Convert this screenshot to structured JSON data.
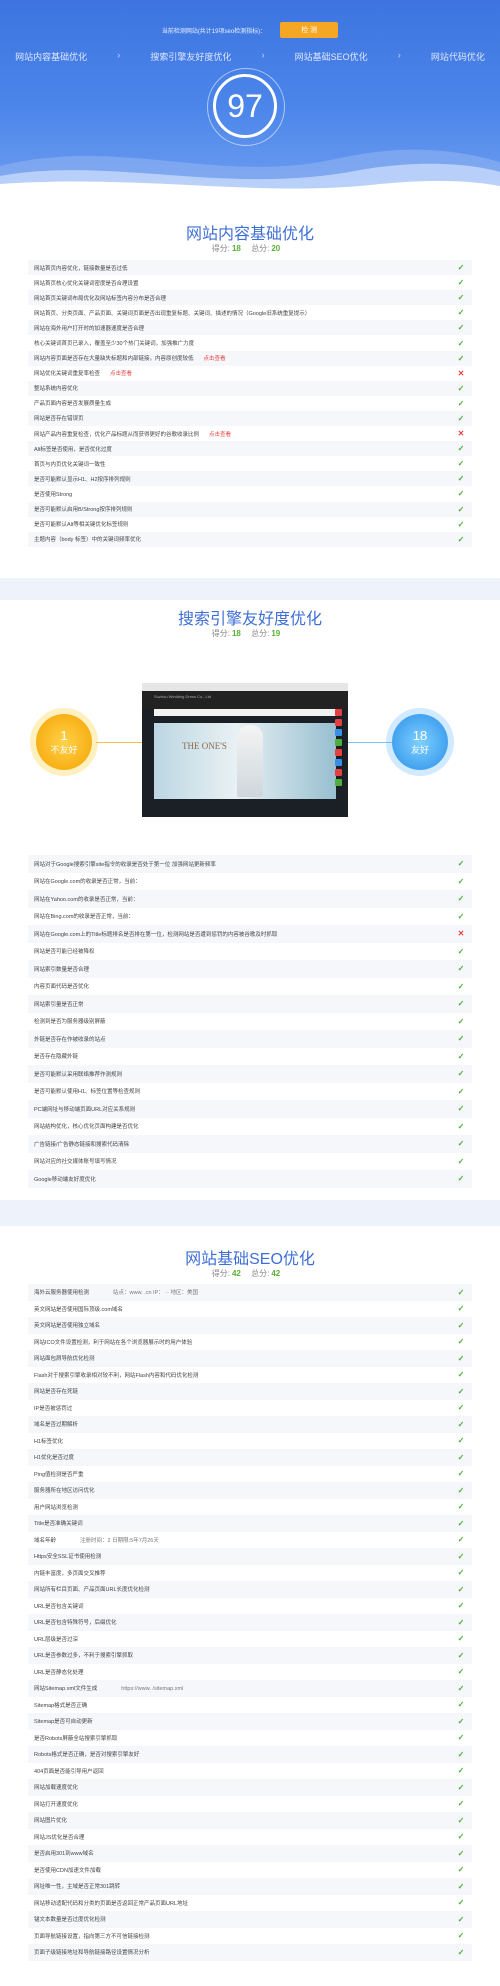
{
  "hero": {
    "hint": "当前检测网站(共计19项seo检测指标)：",
    "button_label": "检 测",
    "nav": [
      "网站内容基础优化",
      "搜索引擎友好度优化",
      "网站基础SEO优化",
      "网站代码优化"
    ],
    "score": "97"
  },
  "colors": {
    "accent": "#3f6fd6",
    "ok": "#4caf3c",
    "bad": "#e54040",
    "warn": "#f5a623"
  },
  "sections": {
    "content": {
      "title": "网站内容基础优化",
      "score_label": "得分:",
      "score": "18",
      "total_label": "总分:",
      "total": "20",
      "rows": [
        {
          "text": "网站首页内容优化，链接数量是否过低",
          "tag": "",
          "status": "ok"
        },
        {
          "text": "网站首页核心优化关键词密度是否合理设置",
          "tag": "",
          "status": "ok"
        },
        {
          "text": "网站首页关键词布局优化及网站标签内容分布是否合理",
          "tag": "",
          "status": "ok"
        },
        {
          "text": "网站首页、分类页面、产品页面、关键词页面是否出现重复标题、关键词、描述的情况（Google旧系统重复提示）",
          "tag": "",
          "status": "ok"
        },
        {
          "text": "网站在海外用户打开时的加速器速度是否合理",
          "tag": "",
          "status": "ok"
        },
        {
          "text": "核心关键词首页已录入，覆盖至少30个热门关键词，加强推广力度",
          "tag": "",
          "status": "ok"
        },
        {
          "text": "网站内容页面是否存在大量缺失标题和内部链接，内容原创度较低",
          "tag": "点击查看",
          "status": "ok"
        },
        {
          "text": "网站优化关键词重复率检查",
          "tag": "点击查看",
          "status": "bad"
        },
        {
          "text": "整站系统内容优化",
          "tag": "",
          "status": "ok"
        },
        {
          "text": "产品页面内容是否发展质量生成",
          "tag": "",
          "status": "ok"
        },
        {
          "text": "网站是否存在错误页",
          "tag": "",
          "status": "ok"
        },
        {
          "text": "网站产品内容重复检查，优化产品标题从而获得更好的谷歌收录比例",
          "tag": "点击查看",
          "status": "bad"
        },
        {
          "text": "Alt标签是否使用，是否优化过度",
          "tag": "",
          "status": "ok"
        },
        {
          "text": "首页与内页优化关键词一致性",
          "tag": "",
          "status": "ok"
        },
        {
          "text": "是否可能默认显示H1、H2按序排列规则",
          "tag": "",
          "status": "ok"
        },
        {
          "text": "是否使用Strong",
          "tag": "",
          "status": "ok"
        },
        {
          "text": "是否可能默认启用B/Strong按序排列规则",
          "tag": "",
          "status": "ok"
        },
        {
          "text": "是否可能默认Alt等相关键优化标签规则",
          "tag": "",
          "status": "ok"
        },
        {
          "text": "主题内容（body 标签）中的关键词频率优化",
          "tag": "",
          "status": "ok"
        }
      ]
    },
    "search": {
      "title": "搜索引擎友好度优化",
      "score_label": "得分:",
      "score": "18",
      "total_label": "总分:",
      "total": "19",
      "left_badge": {
        "num": "1",
        "label": "不友好"
      },
      "right_badge": {
        "num": "18",
        "label": "友好"
      },
      "preview": {
        "site_name": "Suzhou Wedding Dress Co., Ltd",
        "logo": "THE ONE'S"
      },
      "rows": [
        {
          "text": "网站对于Google搜索引擎site指令的收录是否处于第一位 加强网站更新频率",
          "tag": "",
          "status": "ok"
        },
        {
          "text": "网站在Google.com的收录是否正常，当前：",
          "tag": "",
          "status": "ok"
        },
        {
          "text": "网站在Yahoo.com的收录是否正常，当前：",
          "tag": "",
          "status": "ok"
        },
        {
          "text": "网站在Bing.com的收录是否正常，当前：",
          "tag": "",
          "status": "ok"
        },
        {
          "text": "网站在Google.com上的Title标题排名是否排在第一位，检测网站是否遭到惩罚的内容被谷歌及时抓取",
          "tag": "",
          "status": "bad"
        },
        {
          "text": "网站是否可能已经被降权",
          "tag": "",
          "status": "ok"
        },
        {
          "text": "网站索引数量是否合理",
          "tag": "",
          "status": "ok"
        },
        {
          "text": "内容页面代码是否优化",
          "tag": "",
          "status": "ok"
        },
        {
          "text": "网站索引量是否正常",
          "tag": "",
          "status": "ok"
        },
        {
          "text": "检测到是否为服务器级别屏蔽",
          "tag": "",
          "status": "ok"
        },
        {
          "text": "外链是否存在作被收录的站点",
          "tag": "",
          "status": "ok"
        },
        {
          "text": "是否存在隐藏外链",
          "tag": "",
          "status": "ok"
        },
        {
          "text": "是否可能默认采用联络推荐作测规则",
          "tag": "",
          "status": "ok"
        },
        {
          "text": "是否可能默认使用H1、标签位置等检查规则",
          "tag": "",
          "status": "ok"
        },
        {
          "text": "PC端网址与移动端页面URL对应关系规则",
          "tag": "",
          "status": "ok"
        },
        {
          "text": "网站结构优化，核心优化页面构建是否优化",
          "tag": "",
          "status": "ok"
        },
        {
          "text": "广告链接/广告静态链接和搜索代码清除",
          "tag": "",
          "status": "ok"
        },
        {
          "text": "网站对应的社交媒体账号填写情况",
          "tag": "",
          "status": "ok"
        },
        {
          "text": "Google移动端友好度优化",
          "tag": "",
          "status": "ok"
        }
      ]
    },
    "seo": {
      "title": "网站基础SEO优化",
      "score_label": "得分:",
      "score": "42",
      "total_label": "总分:",
      "total": "42",
      "rows": [
        {
          "text": "海外云服务器使用检测",
          "extra": "站点：www.                                .cn IP：           ·· 地区：美国",
          "status": "ok"
        },
        {
          "text": "英文网站是否使用国际顶级.com域名",
          "extra": "",
          "status": "ok"
        },
        {
          "text": "英文网站是否使用独立域名",
          "extra": "",
          "status": "ok"
        },
        {
          "text": "网站ICO文件设置检测，利于网站在各个浏览器展示时的用户体验",
          "extra": "",
          "status": "ok"
        },
        {
          "text": "网站面包屑导航优化检测",
          "extra": "",
          "status": "ok"
        },
        {
          "text": "Flash对于搜索引擎收录相对较不利，网站Flash内容和代码优化检测",
          "extra": "",
          "status": "ok"
        },
        {
          "text": "网站是否存在死链",
          "extra": "",
          "status": "ok"
        },
        {
          "text": "IP是否被惩罚过",
          "extra": "",
          "status": "ok"
        },
        {
          "text": "域名是否过期解析",
          "extra": "",
          "status": "ok"
        },
        {
          "text": "H1标签优化",
          "extra": "",
          "status": "ok"
        },
        {
          "text": "H1优化是否过度",
          "extra": "",
          "status": "ok"
        },
        {
          "text": "Ping值检测是否严重",
          "extra": "",
          "status": "ok"
        },
        {
          "text": "服务器所在地区访问优化",
          "extra": "",
          "status": "ok"
        },
        {
          "text": "用户网站浏览检测",
          "extra": "",
          "status": "ok"
        },
        {
          "text": "Title是否准确关键词",
          "extra": "",
          "status": "ok"
        },
        {
          "text": "域名年龄",
          "extra": "注册时间：2         日期限:5年7月26天",
          "status": "ok"
        },
        {
          "text": "Https安全SSL证书使用检测",
          "extra": "",
          "status": "ok"
        },
        {
          "text": "内链丰富度，多页面交叉推荐",
          "extra": "",
          "status": "ok"
        },
        {
          "text": "网站所有栏目页面、产品页面URL长度优化检测",
          "extra": "",
          "status": "ok"
        },
        {
          "text": "URL是否包含关键词",
          "extra": "",
          "status": "ok"
        },
        {
          "text": "URL是否包含特殊符号，后缀优化",
          "extra": "",
          "status": "ok"
        },
        {
          "text": "URL层级是否过深",
          "extra": "",
          "status": "ok"
        },
        {
          "text": "URL是否参数过多，不利于搜索引擎抓取",
          "extra": "",
          "status": "ok"
        },
        {
          "text": "URL是否静态化处理",
          "extra": "",
          "status": "ok"
        },
        {
          "text": "网站Sitemap.xml文件生成",
          "extra": "https://www.                      /sitemap.xml",
          "status": "ok"
        },
        {
          "text": "Sitemap格式是否正确",
          "extra": "",
          "status": "ok"
        },
        {
          "text": "Sitemap是否可自动更新",
          "extra": "",
          "status": "ok"
        },
        {
          "text": "是否Robots屏蔽全站搜索引擎抓取",
          "extra": "",
          "status": "ok"
        },
        {
          "text": "Robots格式是否正确，是否对搜索引擎友好",
          "extra": "",
          "status": "ok"
        },
        {
          "text": "404页面是否能引导用户返回",
          "extra": "",
          "status": "ok"
        },
        {
          "text": "网站加载速度优化",
          "extra": "",
          "status": "ok"
        },
        {
          "text": "网站打开速度优化",
          "extra": "",
          "status": "ok"
        },
        {
          "text": "网站图片优化",
          "extra": "",
          "status": "ok"
        },
        {
          "text": "网站JS优化是否合理",
          "extra": "",
          "status": "ok"
        },
        {
          "text": "是否启用301到www域名",
          "extra": "",
          "status": "ok"
        },
        {
          "text": "是否使用CDN加速文件加载",
          "extra": "",
          "status": "ok"
        },
        {
          "text": "网址唯一性，主域是否正常301跳转",
          "extra": "",
          "status": "ok"
        },
        {
          "text": "网站移动适配代码和分类的页面是否返回正常产品页面URL地址",
          "extra": "",
          "status": "ok"
        },
        {
          "text": "锚文本数量是否过度优化检测",
          "extra": "",
          "status": "ok"
        },
        {
          "text": "页面导航链接设置，指向第三方不可信链接检测",
          "extra": "",
          "status": "ok"
        },
        {
          "text": "页面子级链接地址和导航链接路径设置情况分析",
          "extra": "",
          "status": "ok"
        }
      ]
    }
  },
  "icons": {
    "ok": "✓",
    "bad": "✕"
  }
}
